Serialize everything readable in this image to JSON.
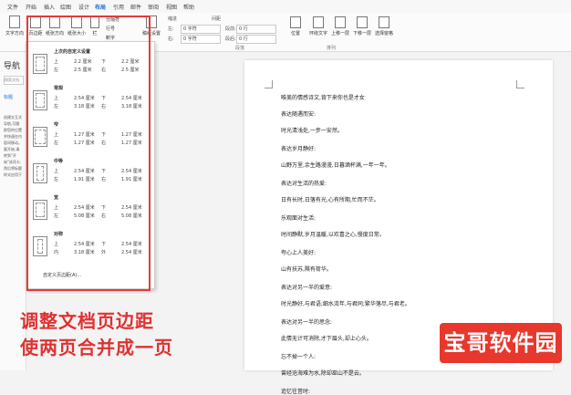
{
  "tabs": [
    "文件",
    "开始",
    "插入",
    "绘图",
    "设计",
    "布局",
    "引用",
    "邮件",
    "审阅",
    "视图",
    "帮助"
  ],
  "active_tab": "布局",
  "ribbon": {
    "buttons": [
      "文字方向",
      "页边距",
      "纸张方向",
      "纸张大小",
      "栏",
      "分隔符",
      "行号",
      "断字",
      "稿纸设置"
    ],
    "indent_label": "缩进",
    "spacing_label": "间距",
    "left_label": "左:",
    "right_label": "右:",
    "before_label": "段前:",
    "after_label": "段后:",
    "left_value": "0 字符",
    "right_value": "0 字符",
    "before_value": "0 行",
    "after_value": "0 行",
    "arrange_buttons": [
      "位置",
      "环绕文字",
      "上移一层",
      "下移一层",
      "选择窗格"
    ],
    "group_paragraph": "段落",
    "group_arrange": "排列"
  },
  "nav": {
    "title": "导航",
    "search_placeholder": "搜索文档",
    "tab": "标题",
    "desc": "创建交互式导航,可跟踪您的位置并快速在内容间移动。要开始,请转到\"开始\"选项卡,然后将标题样式应用于文档中的标题。"
  },
  "margin_presets": [
    {
      "name": "常规",
      "top_label": "上",
      "top": "2.54 厘米",
      "bottom_label": "下",
      "bottom": "2.54 厘米",
      "left_label": "左",
      "left": "3.18 厘米",
      "right_label": "右",
      "right": "3.18 厘米"
    },
    {
      "name": "窄",
      "top_label": "上",
      "top": "1.27 厘米",
      "bottom_label": "下",
      "bottom": "1.27 厘米",
      "left_label": "左",
      "left": "1.27 厘米",
      "right_label": "右",
      "right": "1.27 厘米"
    },
    {
      "name": "中等",
      "top_label": "上",
      "top": "2.54 厘米",
      "bottom_label": "下",
      "bottom": "2.54 厘米",
      "left_label": "左",
      "left": "1.91 厘米",
      "right_label": "右",
      "right": "1.91 厘米"
    },
    {
      "name": "宽",
      "top_label": "上",
      "top": "2.54 厘米",
      "bottom_label": "下",
      "bottom": "2.54 厘米",
      "left_label": "左",
      "left": "5.08 厘米",
      "right_label": "右",
      "right": "5.08 厘米"
    },
    {
      "name": "对称",
      "top_label": "上",
      "top": "2.54 厘米",
      "bottom_label": "下",
      "bottom": "2.54 厘米",
      "left_label": "内",
      "left": "3.18 厘米",
      "right_label": "外",
      "right": "2.54 厘米"
    }
  ],
  "last_custom": {
    "name": "上次的自定义设置",
    "top_label": "上",
    "top": "2.2 厘米",
    "bottom_label": "下",
    "bottom": "2.2 厘米",
    "left_label": "左",
    "left": "2.5 厘米",
    "right_label": "右",
    "right": "2.5 厘米"
  },
  "custom_margins_label": "自定义页边距(A)...",
  "document_lines": [
    "唯美的情感诗文,背下来你也是才女",
    "表达随遇而安:",
    "时光清浅处,一步一安然。",
    "表达岁月静好:",
    "山野万里,余生路漫漫,日暮酒杯满,一年一年。",
    "表达对生活的热爱:",
    "日有长时,日落有光,心有所期,忙而不茫。",
    "乐观面对生活:",
    "时间静默,岁月温暖,以欢喜之心,慢度日常。",
    "夸心上人美好:",
    "山有扶苏,隰有荷华。",
    "表达对另一半的爱意:",
    "时光静好,与君语;细水流年,与君同;繁华落尽,与君老。",
    "表达对另一半的思念:",
    "此情无计可消除,才下眉头,却上心头。",
    "忘不掉一个人:",
    "曾经沧海难为水,除却巫山不是云。",
    "追忆往昔时:"
  ],
  "caption": {
    "line1": "调整文档页边距",
    "line2": "使两页合并成一页"
  },
  "watermark": "宝哥软件园"
}
